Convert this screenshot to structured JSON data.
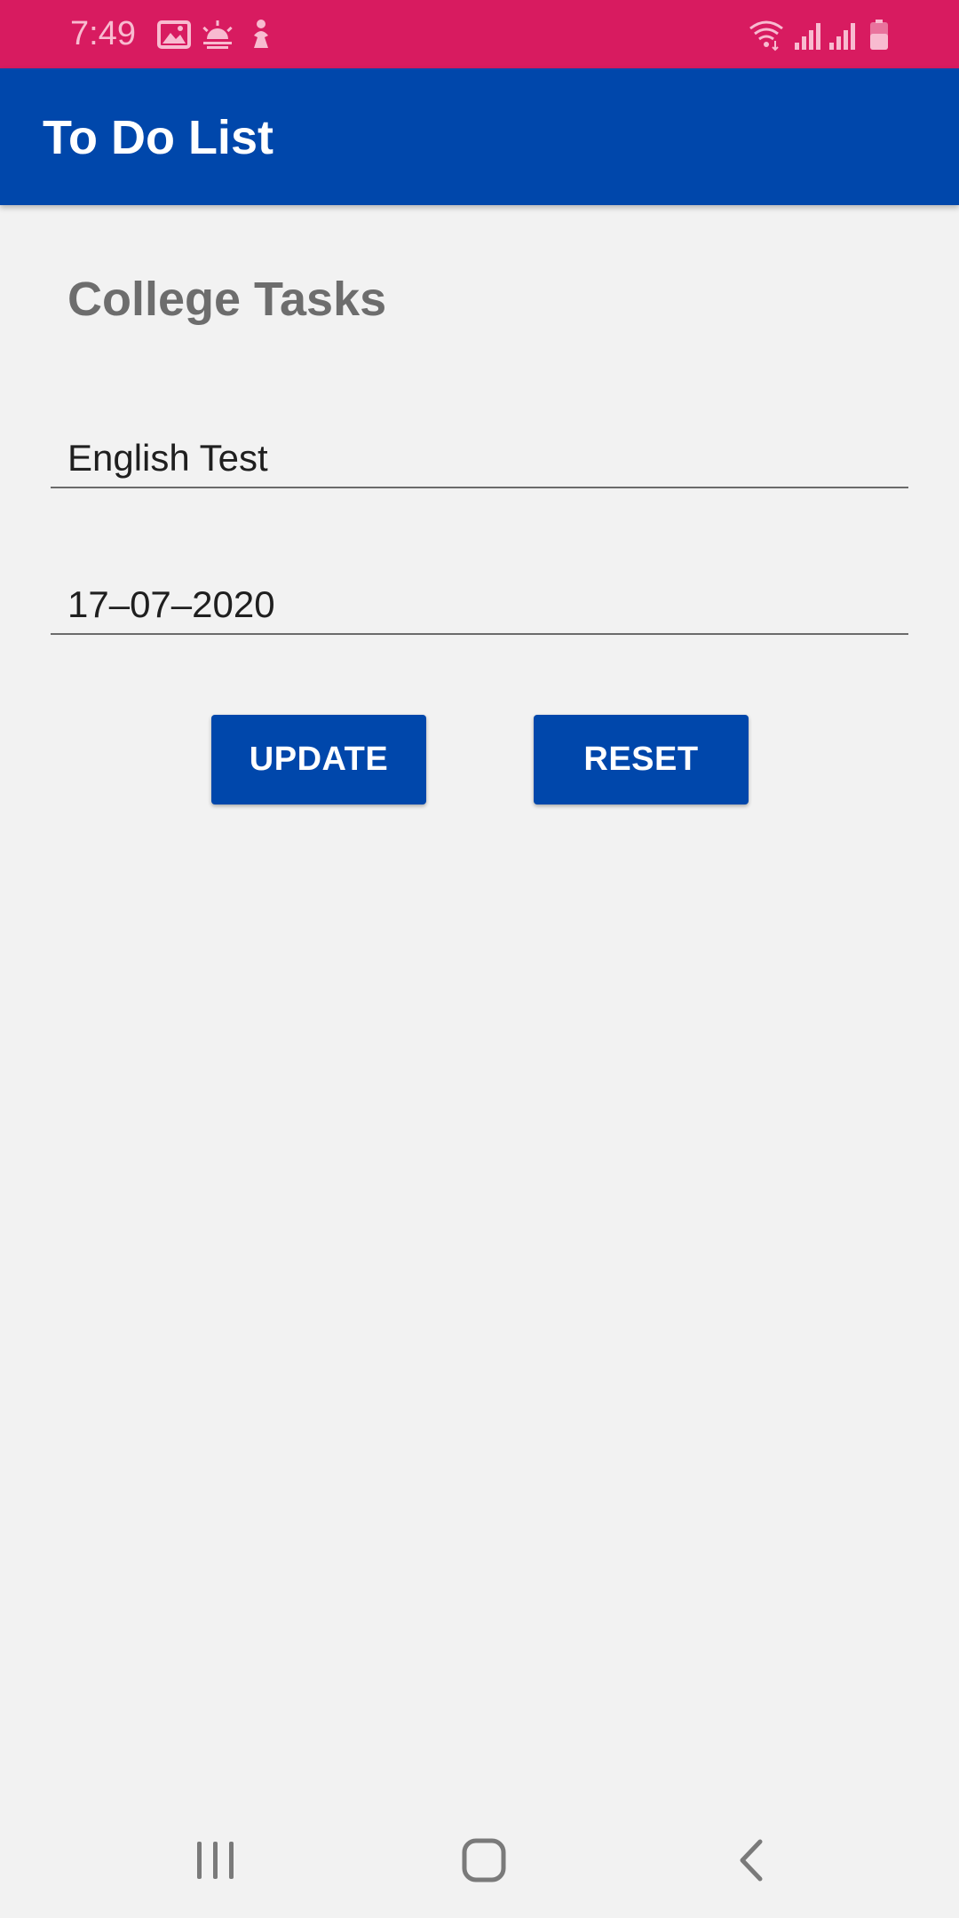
{
  "status_bar": {
    "time": "7:49",
    "background_color": "#d81b60",
    "left_icons": [
      "gallery-icon",
      "weather-icon",
      "notification-icon"
    ],
    "right_icons": [
      "wifi-icon",
      "signal-icon",
      "signal-icon",
      "battery-icon"
    ]
  },
  "app_bar": {
    "title": "To Do List",
    "background_color": "#0047ab"
  },
  "main": {
    "list_title": "College Tasks",
    "task_name_value": "English Test",
    "task_date_value": "17–07–2020",
    "update_label": "UPDATE",
    "reset_label": "RESET"
  },
  "nav_bar": {
    "icons": [
      "recent-apps-icon",
      "home-icon",
      "back-icon"
    ]
  }
}
